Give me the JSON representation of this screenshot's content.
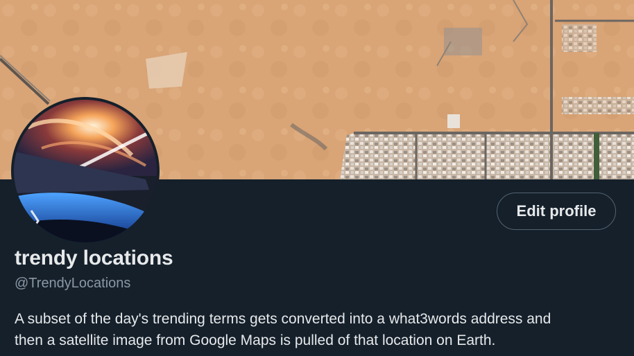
{
  "profile": {
    "display_name": "trendy locations",
    "handle": "@TrendyLocations",
    "bio_line1": "A subset of the day's trending terms gets converted into a what3words address and",
    "bio_line2": "then a satellite image from Google Maps is pulled of that location on Earth.",
    "edit_button_label": "Edit profile"
  },
  "banner": {
    "description_icon": "satellite-map-icon"
  },
  "avatar": {
    "description_icon": "earth-orbit-photo-icon"
  },
  "colors": {
    "background": "#15202b",
    "primary_text": "#e7e9ea",
    "secondary_text": "#8b98a5",
    "button_border": "#536471",
    "desert": "#d9a476"
  }
}
